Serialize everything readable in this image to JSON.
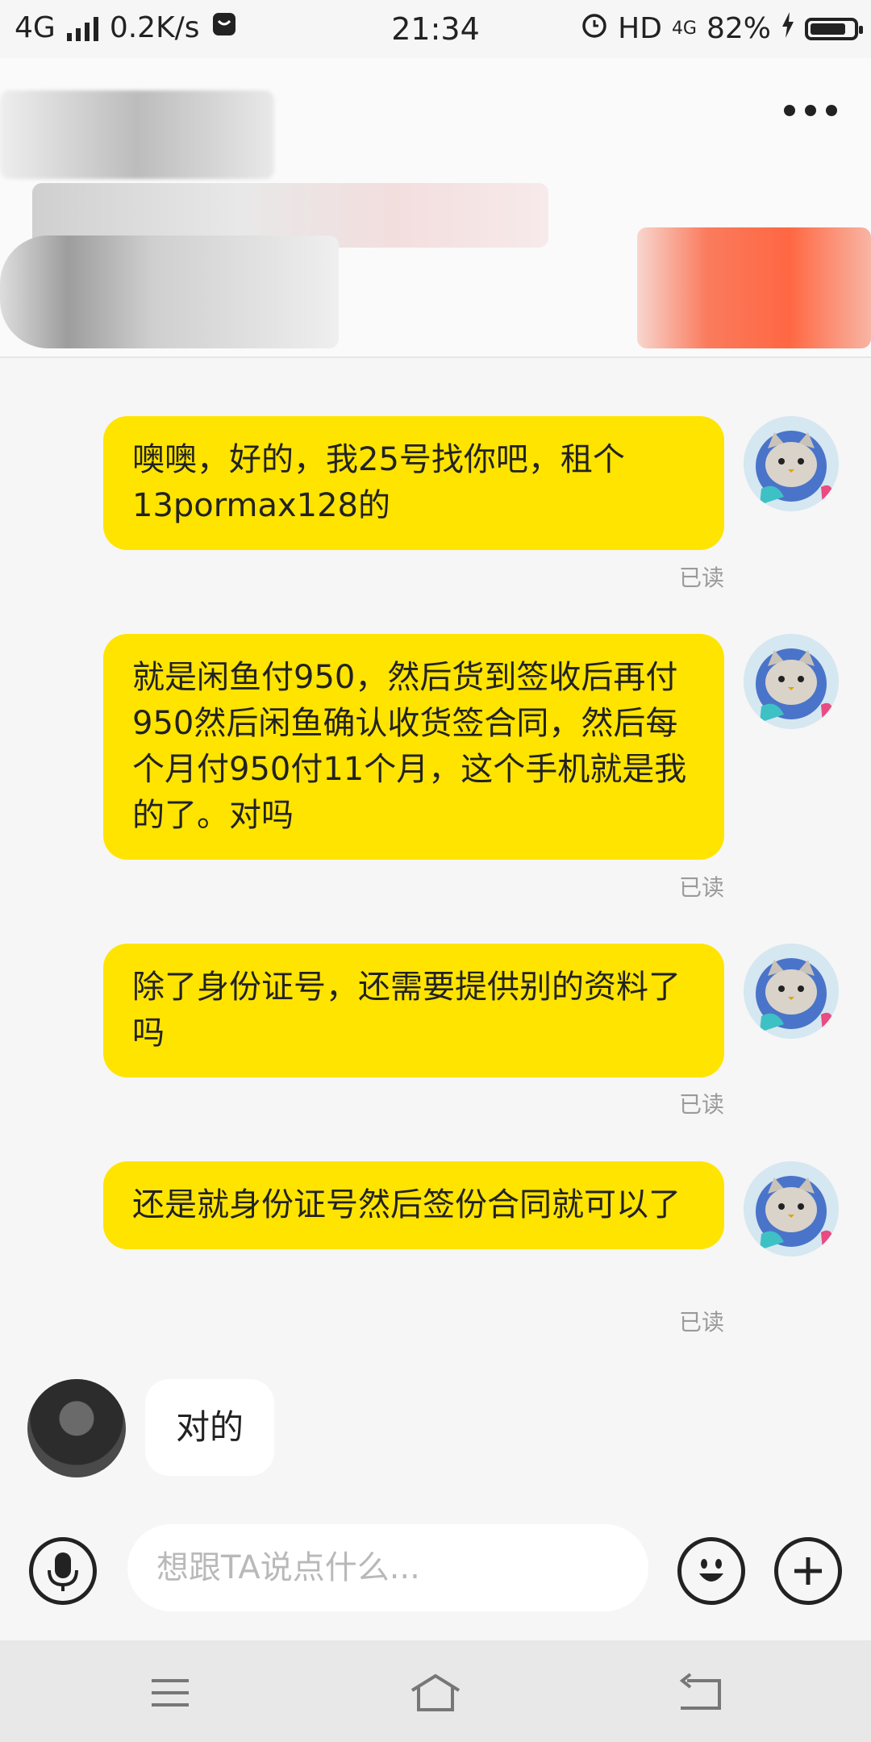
{
  "status_bar": {
    "network": "4G",
    "speed": "0.2K/s",
    "time": "21:34",
    "hd": "HD",
    "net2": "4G",
    "battery": "82%",
    "battery_level": 0.82
  },
  "header": {
    "more_icon": "more-icon"
  },
  "messages": [
    {
      "side": "right",
      "text": "噢噢，好的，我25号找你吧，租个13pormax128的",
      "status": "已读"
    },
    {
      "side": "right",
      "text": "就是闲鱼付950，然后货到签收后再付950然后闲鱼确认收货签合同，然后每个月付950付11个月，这个手机就是我的了。对吗",
      "status": "已读"
    },
    {
      "side": "right",
      "text": "除了身份证号，还需要提供别的资料了吗",
      "status": "已读"
    },
    {
      "side": "right",
      "text": "还是就身份证号然后签份合同就可以了",
      "status": "已读"
    },
    {
      "side": "left",
      "text": "对的"
    }
  ],
  "input_bar": {
    "placeholder": "想跟TA说点什么...",
    "voice_icon": "microphone-icon",
    "emoji_icon": "emoji-icon",
    "add_icon": "plus-icon"
  },
  "nav_bar": {
    "menu_icon": "menu-icon",
    "home_icon": "home-icon",
    "back_icon": "back-icon"
  },
  "colors": {
    "bubble_self": "#ffe400",
    "bubble_other": "#ffffff",
    "background": "#f6f6f6"
  }
}
